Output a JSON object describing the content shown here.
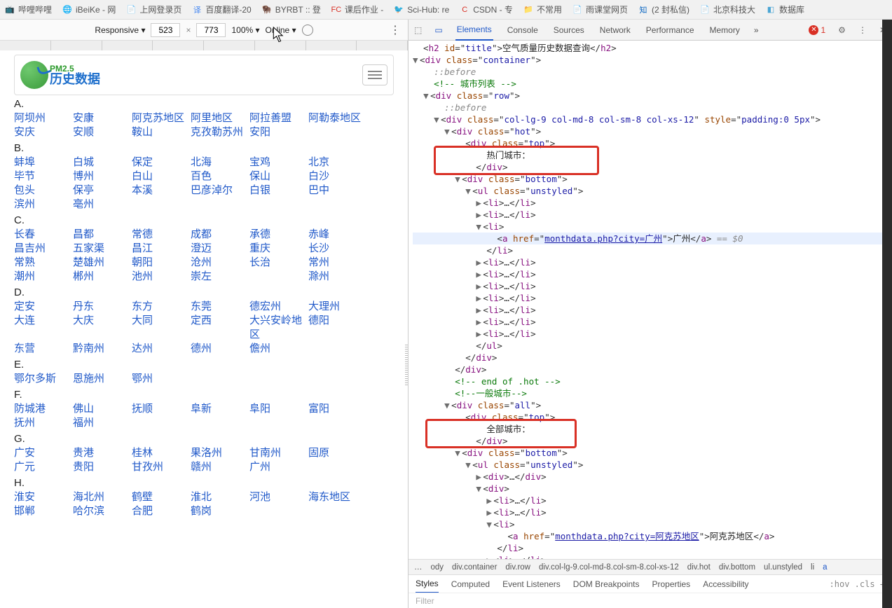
{
  "bookmarks": [
    {
      "icon": "📺",
      "color": "#ff6aa9",
      "label": "哔哩哔哩"
    },
    {
      "icon": "🌐",
      "color": "#57b45b",
      "label": "iBeiKe - 网"
    },
    {
      "icon": "📄",
      "color": "#888",
      "label": "上网登录页"
    },
    {
      "icon": "译",
      "color": "#4688f1",
      "label": "百度翻译-20"
    },
    {
      "icon": "🦬",
      "color": "#c29b4a",
      "label": "BYRBT :: 登"
    },
    {
      "icon": "FC",
      "color": "#d93025",
      "label": "课后作业 -"
    },
    {
      "icon": "🐦",
      "color": "#f29900",
      "label": "Sci-Hub: re"
    },
    {
      "icon": "C",
      "color": "#d93025",
      "label": "CSDN - 专"
    },
    {
      "icon": "📁",
      "color": "#888",
      "label": "不常用"
    },
    {
      "icon": "📄",
      "color": "#888",
      "label": "雨课堂网页"
    },
    {
      "icon": "知",
      "color": "#0a66c2",
      "label": "(2 封私信)"
    },
    {
      "icon": "📄",
      "color": "#888",
      "label": "北京科技大"
    },
    {
      "icon": "◧",
      "color": "#4aa5d4",
      "label": "数据库"
    }
  ],
  "devToolbar": {
    "device": "Responsive",
    "w": "523",
    "h": "773",
    "zoom": "100%",
    "throttle": "Online"
  },
  "logo": {
    "small": "PM2.5",
    "big": "历史数据"
  },
  "groups": [
    {
      "letter": "A.",
      "cities": [
        "阿坝州",
        "安康",
        "阿克苏地区",
        "阿里地区",
        "阿拉善盟",
        "阿勒泰地区",
        "安庆",
        "安顺",
        "鞍山",
        "克孜勒苏州",
        "安阳"
      ]
    },
    {
      "letter": "B.",
      "cities": [
        "蚌埠",
        "白城",
        "保定",
        "北海",
        "宝鸡",
        "北京",
        "毕节",
        "博州",
        "白山",
        "百色",
        "保山",
        "白沙",
        "包头",
        "保亭",
        "本溪",
        "巴彦淖尔",
        "白银",
        "巴中",
        "滨州",
        "亳州"
      ]
    },
    {
      "letter": "C.",
      "cities": [
        "长春",
        "昌都",
        "常德",
        "成都",
        "承德",
        "赤峰",
        "昌吉州",
        "五家渠",
        "昌江",
        "澄迈",
        "重庆",
        "长沙",
        "常熟",
        "楚雄州",
        "朝阳",
        "沧州",
        "长治",
        "常州",
        "潮州",
        "郴州",
        "池州",
        "崇左",
        "",
        "滁州"
      ]
    },
    {
      "letter": "D.",
      "cities": [
        "定安",
        "丹东",
        "东方",
        "东莞",
        "德宏州",
        "大理州",
        "大连",
        "大庆",
        "大同",
        "定西",
        "大兴安岭地区",
        "德阳",
        "东营",
        "黔南州",
        "达州",
        "德州",
        "儋州"
      ]
    },
    {
      "letter": "E.",
      "cities": [
        "鄂尔多斯",
        "恩施州",
        "鄂州"
      ]
    },
    {
      "letter": "F.",
      "cities": [
        "防城港",
        "佛山",
        "抚顺",
        "阜新",
        "阜阳",
        "富阳",
        "抚州",
        "福州"
      ]
    },
    {
      "letter": "G.",
      "cities": [
        "广安",
        "贵港",
        "桂林",
        "果洛州",
        "甘南州",
        "固原",
        "广元",
        "贵阳",
        "甘孜州",
        "赣州",
        "广州"
      ]
    },
    {
      "letter": "H.",
      "cities": [
        "淮安",
        "海北州",
        "鹤壁",
        "淮北",
        "河池",
        "海东地区",
        "邯郸",
        "哈尔滨",
        "合肥",
        "鹤岗"
      ]
    }
  ],
  "devtoolsTabs": [
    "Elements",
    "Console",
    "Sources",
    "Network",
    "Performance",
    "Memory"
  ],
  "errorCount": "1",
  "dom": {
    "title": "空气质量历史数据查询",
    "link1": "monthdata.php?city=广州",
    "linkText1": "广州",
    "link2": "monthdata.php?city=阿克苏地区",
    "linkText2": "阿克苏地区",
    "hotTop": "热门城市：",
    "allTop": "全部城市："
  },
  "breadcrumbs": [
    "ody",
    "div.container",
    "div.row",
    "div.col-lg-9.col-md-8.col-sm-8.col-xs-12",
    "div.hot",
    "div.bottom",
    "ul.unstyled",
    "li",
    "a"
  ],
  "styleTabs": [
    "Styles",
    "Computed",
    "Event Listeners",
    "DOM Breakpoints",
    "Properties",
    "Accessibility"
  ],
  "styleRight": ":hov .cls +",
  "filter": "Filter"
}
